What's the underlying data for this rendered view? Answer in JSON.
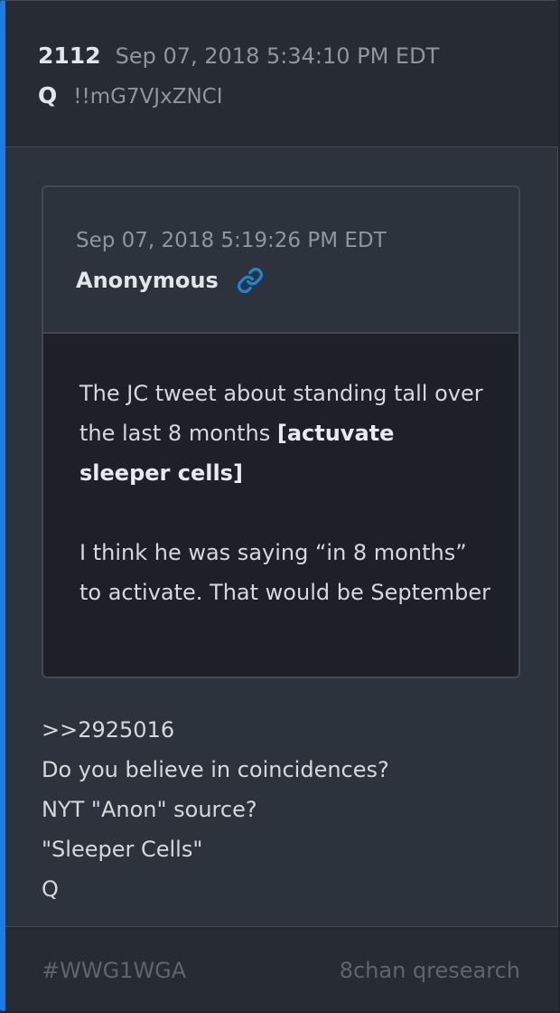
{
  "header": {
    "post_number": "2112",
    "timestamp": "Sep 07, 2018 5:34:10 PM EDT",
    "author": "Q",
    "tripcode": "!!mG7VJxZNCI"
  },
  "quoted_post": {
    "timestamp": "Sep 07, 2018 5:19:26 PM EDT",
    "author": "Anonymous",
    "link_icon": "link-icon",
    "body": {
      "p1_text": "The JC tweet about standing tall over the last 8 months ",
      "p1_bold": "[actuvate sleeper cells]",
      "p2_text": "I think he was saying “in 8 months” to activate.  That would be September"
    }
  },
  "post_body": {
    "lines": [
      ">>2925016",
      "Do you believe in coincidences?",
      "NYT \"Anon\" source?",
      "\"Sleeper Cells\"",
      "Q"
    ]
  },
  "footer": {
    "hashtag": "#WWG1WGA",
    "source": "8chan qresearch"
  },
  "colors": {
    "accent_bar": "#1e7be5",
    "link_icon": "#1a84d6",
    "card_background": "#2d333d",
    "quote_background": "#1d2026"
  }
}
